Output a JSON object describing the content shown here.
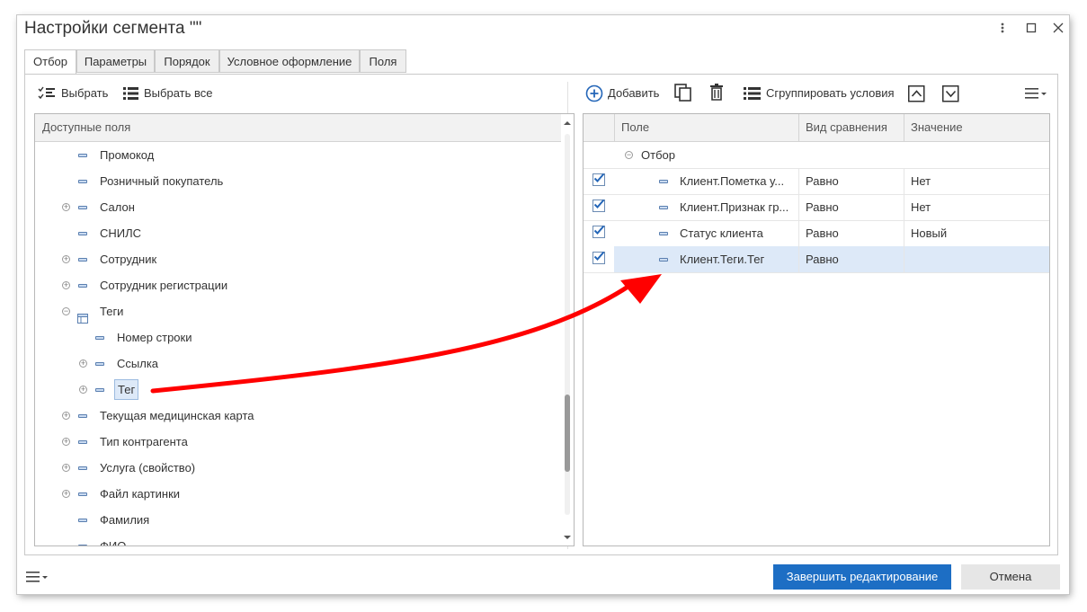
{
  "window": {
    "title": "Настройки сегмента \"\"",
    "menu_icon": "kebab-menu-icon",
    "maximize_icon": "maximize-icon",
    "close_icon": "close-icon"
  },
  "tabs": [
    {
      "label": "Отбор",
      "active": true
    },
    {
      "label": "Параметры",
      "active": false
    },
    {
      "label": "Порядок",
      "active": false
    },
    {
      "label": "Условное оформление",
      "active": false
    },
    {
      "label": "Поля",
      "active": false
    }
  ],
  "left_toolbar": {
    "select_label": "Выбрать",
    "select_all_label": "Выбрать все"
  },
  "available_fields": {
    "header": "Доступные поля",
    "items": [
      {
        "label": "Промокод",
        "expandable": false,
        "expanded": false,
        "level": 0,
        "icon": "field-icon"
      },
      {
        "label": "Розничный покупатель",
        "expandable": false,
        "expanded": false,
        "level": 0,
        "icon": "field-icon"
      },
      {
        "label": "Салон",
        "expandable": true,
        "expanded": false,
        "level": 0,
        "icon": "field-icon"
      },
      {
        "label": "СНИЛС",
        "expandable": false,
        "expanded": false,
        "level": 0,
        "icon": "field-icon"
      },
      {
        "label": "Сотрудник",
        "expandable": true,
        "expanded": false,
        "level": 0,
        "icon": "field-icon"
      },
      {
        "label": "Сотрудник регистрации",
        "expandable": true,
        "expanded": false,
        "level": 0,
        "icon": "field-icon"
      },
      {
        "label": "Теги",
        "expandable": true,
        "expanded": true,
        "level": 0,
        "icon": "table-icon"
      },
      {
        "label": "Номер строки",
        "expandable": false,
        "expanded": false,
        "level": 1,
        "icon": "field-icon"
      },
      {
        "label": "Ссылка",
        "expandable": true,
        "expanded": false,
        "level": 1,
        "icon": "field-icon"
      },
      {
        "label": "Тег",
        "expandable": true,
        "expanded": false,
        "level": 1,
        "icon": "field-icon",
        "selected": true
      },
      {
        "label": "Текущая медицинская карта",
        "expandable": true,
        "expanded": false,
        "level": 0,
        "icon": "field-icon"
      },
      {
        "label": "Тип контрагента",
        "expandable": true,
        "expanded": false,
        "level": 0,
        "icon": "field-icon"
      },
      {
        "label": "Услуга (свойство)",
        "expandable": true,
        "expanded": false,
        "level": 0,
        "icon": "field-icon"
      },
      {
        "label": "Файл картинки",
        "expandable": true,
        "expanded": false,
        "level": 0,
        "icon": "field-icon"
      },
      {
        "label": "Фамилия",
        "expandable": false,
        "expanded": false,
        "level": 0,
        "icon": "field-icon"
      },
      {
        "label": "ФИО",
        "expandable": false,
        "expanded": false,
        "level": 0,
        "icon": "field-icon"
      }
    ]
  },
  "right_toolbar": {
    "add_label": "Добавить",
    "copy_icon": "copy-icon",
    "delete_icon": "trash-icon",
    "group_label": "Сгруппировать условия",
    "move_up_icon": "move-up-icon",
    "move_down_icon": "move-down-icon",
    "more_icon": "more-menu-icon"
  },
  "filter_grid": {
    "columns": [
      "Поле",
      "Вид сравнения",
      "Значение"
    ],
    "group_label": "Отбор",
    "rows": [
      {
        "checked": true,
        "field": "Клиент.Пометка у...",
        "comparison": "Равно",
        "value": "Нет",
        "selected": false
      },
      {
        "checked": true,
        "field": "Клиент.Признак гр...",
        "comparison": "Равно",
        "value": "Нет",
        "selected": false
      },
      {
        "checked": true,
        "field": "Статус клиента",
        "comparison": "Равно",
        "value": "Новый",
        "selected": false
      },
      {
        "checked": true,
        "field": "Клиент.Теги.Тег",
        "comparison": "Равно",
        "value": "",
        "selected": true
      }
    ]
  },
  "footer": {
    "menu_icon": "hamburger-menu-icon",
    "finish_label": "Завершить редактирование",
    "cancel_label": "Отмена"
  },
  "colors": {
    "primary_button": "#1d6ec4",
    "selection": "#dde9f8",
    "arrow": "#ff0000",
    "checkbox_accent": "#2466b8"
  }
}
